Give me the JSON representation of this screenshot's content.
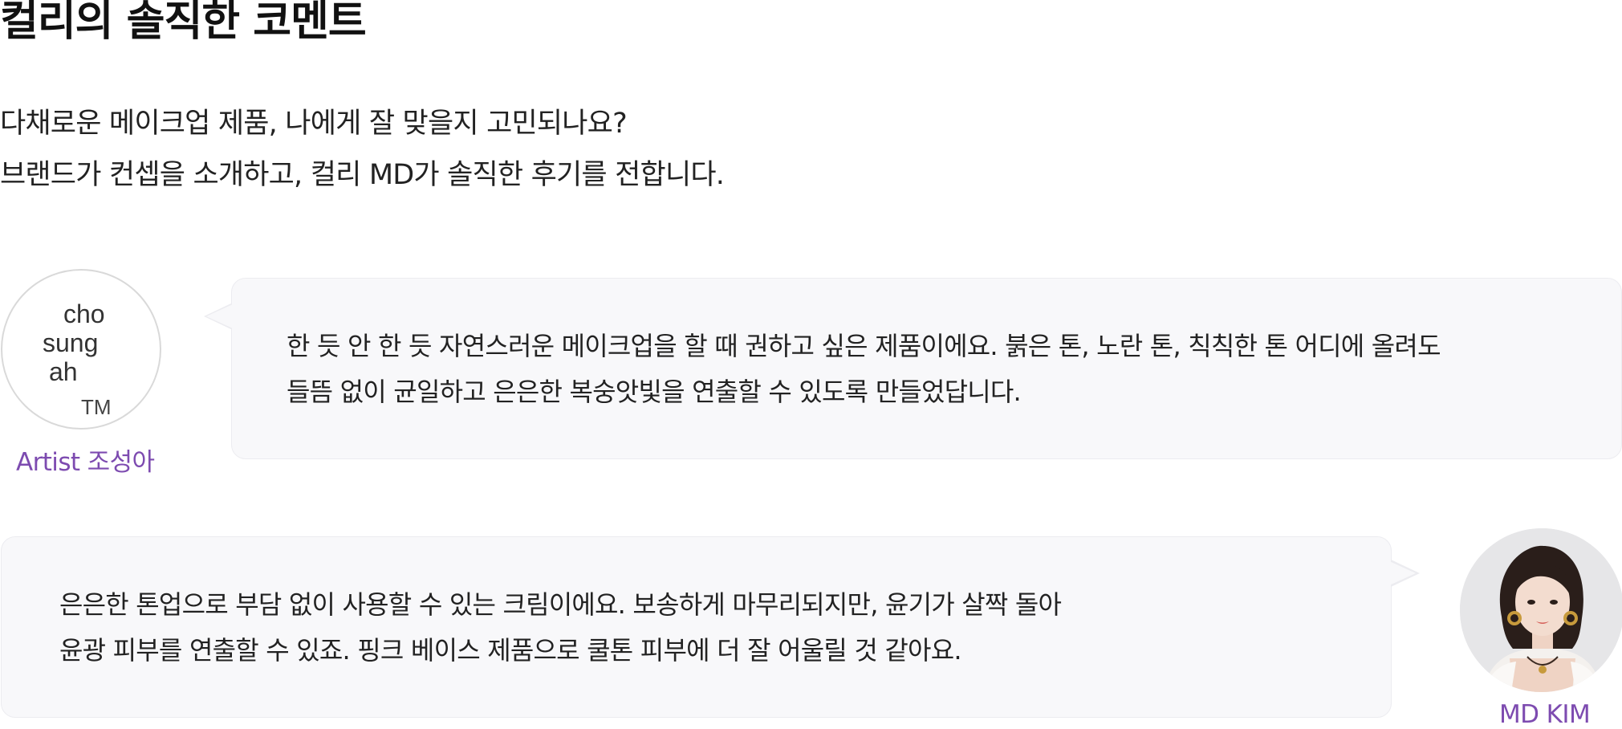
{
  "page": {
    "title": "컬리의 솔직한 코멘트",
    "intro_lines": [
      "다채로운 메이크업 제품, 나에게 잘 맞을지 고민되나요?",
      "브랜드가 컨셉을 소개하고, 컬리 MD가 솔직한 후기를 전합니다."
    ]
  },
  "comments": [
    {
      "logo_lines": [
        "cho",
        "sung",
        "ah",
        "TM"
      ],
      "caption": "Artist 조성아",
      "text_lines": [
        "한 듯 안 한 듯 자연스러운 메이크업을 할 때 권하고 싶은 제품이에요. 붉은 톤, 노란 톤, 칙칙한 톤 어디에 올려도",
        "들뜸 없이 균일하고 은은한 복숭앗빛을 연출할 수 있도록 만들었답니다."
      ]
    },
    {
      "caption": "MD KIM",
      "text_lines": [
        "은은한 톤업으로 부담 없이 사용할 수 있는 크림이에요. 보송하게 마무리되지만, 윤기가 살짝 돌아",
        "윤광 피부를 연출할 수 있죠. 핑크 베이스 제품으로 쿨톤 피부에 더 잘 어울릴 것 같아요."
      ]
    }
  ],
  "colors": {
    "caption": "#7d4bb0",
    "bubble_bg": "#f8f8fa",
    "bubble_border": "#ececf0"
  }
}
